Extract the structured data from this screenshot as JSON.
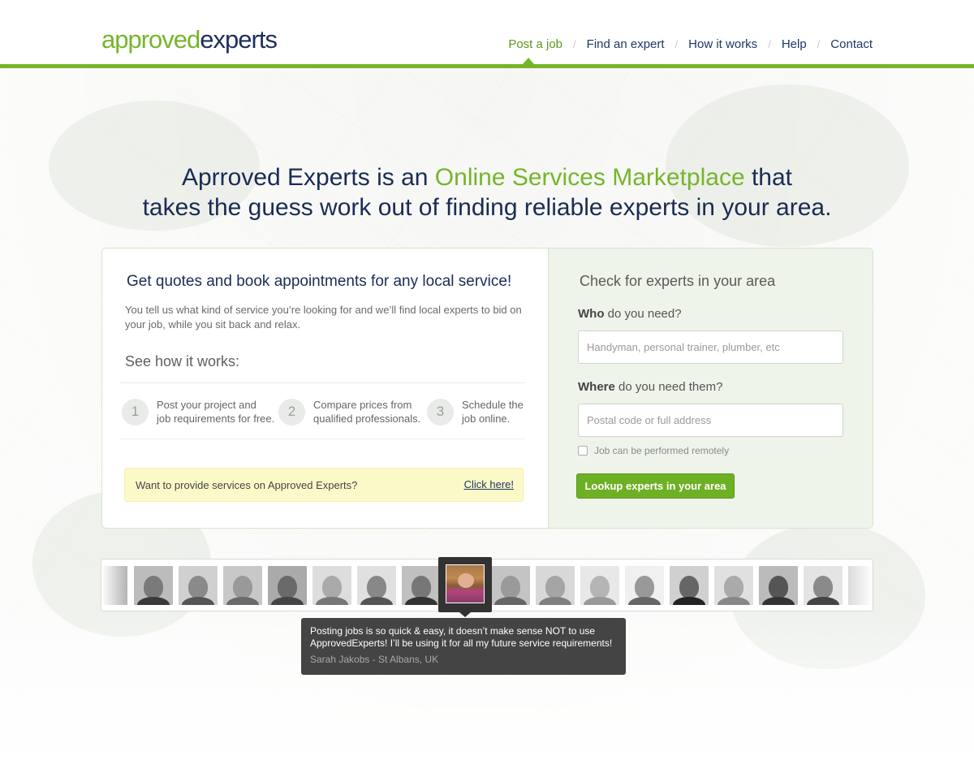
{
  "brand": {
    "logo_part1": "approved",
    "logo_part2": "experts"
  },
  "nav": {
    "items": [
      {
        "label": "Post a job",
        "active": true
      },
      {
        "label": "Find an expert",
        "active": false
      },
      {
        "label": "How it works",
        "active": false
      },
      {
        "label": "Help",
        "active": false
      },
      {
        "label": "Contact",
        "active": false
      }
    ],
    "separator": "/"
  },
  "headline": {
    "part1": "Aprroved Experts is an ",
    "highlight": "Online Services Marketplace",
    "part2": " that",
    "line2": "takes the guess work out of finding reliable experts in your area."
  },
  "intro": {
    "title": "Get quotes and book appointments for any local service!",
    "description": "You tell us what kind of service you’re looking for and we’ll find local experts to bid on your job, while you sit back and relax.",
    "how_title": "See how it works:",
    "steps": [
      {
        "num": "1",
        "line1": "Post your project and",
        "line2": "job requirements for free."
      },
      {
        "num": "2",
        "line1": "Compare prices from",
        "line2": "qualified professionals."
      },
      {
        "num": "3",
        "line1": "Schedule the",
        "line2": "job online."
      }
    ],
    "promo_text": "Want to provide services on Approved Experts?",
    "promo_link": "Click here!"
  },
  "search": {
    "title": "Check for experts in your area",
    "who_bold": "Who",
    "who_rest": " do you need?",
    "who_placeholder": "Handyman, personal trainer, plumber, etc",
    "where_bold": "Where",
    "where_rest": " do you need them?",
    "where_placeholder": "Postal code or full address",
    "remote_label": "Job can be performed remotely",
    "remote_checked": false,
    "button_label": "Lookup experts in your area"
  },
  "testimonial": {
    "quote": "Posting jobs is so quick & easy, it doesn’t make sense NOT to use ApprovedExperts! I’ll be using it for all my future service requirements!",
    "author": "Sarah Jakobs - St Albans, UK"
  },
  "colors": {
    "brand_green": "#76b52b",
    "brand_navy": "#1d2f5e",
    "promo_yellow": "#fcf9c8",
    "tooltip_bg": "#444444"
  }
}
